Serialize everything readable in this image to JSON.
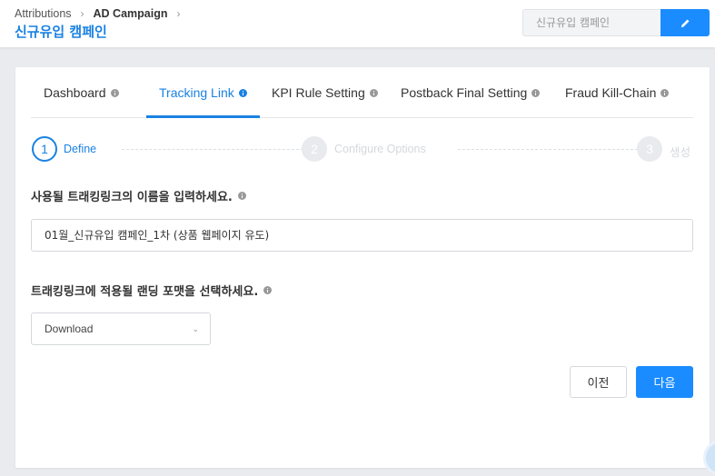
{
  "breadcrumb": {
    "items": [
      "Attributions",
      "AD Campaign"
    ],
    "separator": "›"
  },
  "page_title": "신규유입 캠페인",
  "title_field": {
    "value": "신규유입 캠페인"
  },
  "tabs": [
    {
      "label": "Dashboard",
      "active": false
    },
    {
      "label": "Tracking Link",
      "active": true
    },
    {
      "label": "KPI Rule Setting",
      "active": false
    },
    {
      "label": "Postback Final Setting",
      "active": false
    },
    {
      "label": "Fraud Kill-Chain",
      "active": false
    }
  ],
  "steps": [
    {
      "number": "1",
      "label": "Define",
      "state": "active"
    },
    {
      "number": "2",
      "label": "Configure Options",
      "state": "inactive"
    },
    {
      "number": "3",
      "label": "생성",
      "state": "inactive"
    }
  ],
  "form": {
    "name_label": "사용될 트래킹링크의 이름을 입력하세요.",
    "name_value": "01월_신규유입 캠페인_1차 (상품 웹페이지 유도)",
    "format_label": "트래킹링크에 적용될 랜딩 포맷을 선택하세요.",
    "format_value": "Download"
  },
  "buttons": {
    "prev": "이전",
    "next": "다음"
  },
  "colors": {
    "accent": "#1a82e2",
    "primary_button": "#1a8cff"
  }
}
